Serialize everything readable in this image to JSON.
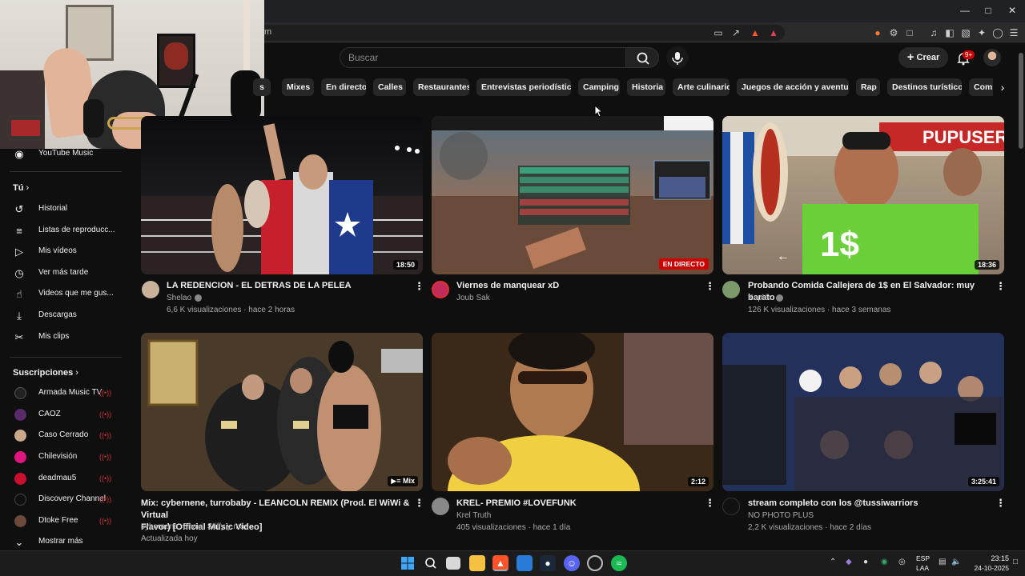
{
  "browser": {
    "url_text": "m",
    "window_controls": [
      "minimize",
      "maximize",
      "close"
    ]
  },
  "header": {
    "search_placeholder": "Buscar",
    "create_label": "Crear",
    "notifications_badge": "9+"
  },
  "chips": [
    "s",
    "Mixes",
    "En directo",
    "Calles",
    "Restaurantes",
    "Entrevistas periodísticas",
    "Camping",
    "Historia",
    "Arte culinario",
    "Juegos de acción y aventuras",
    "Rap",
    "Destinos turísticos",
    "Comp"
  ],
  "sidebar": {
    "top_item": "YouTube Music",
    "you_header": "Tú",
    "you_items": [
      "Historial",
      "Listas de reproducc...",
      "Mis vídeos",
      "Ver más tarde",
      "Videos que me gus...",
      "Descargas",
      "Mis clips"
    ],
    "subs_header": "Suscripciones",
    "subs_items": [
      "Armada Music TV",
      "CAOZ",
      "Caso Cerrado",
      "Chilevisión",
      "deadmau5",
      "Discovery Channel",
      "Dtoke Free"
    ],
    "show_more": "Mostrar más"
  },
  "videos": [
    {
      "title": "LA REDENCION - EL DETRAS DE LA PELEA",
      "channel": "Shelao",
      "meta": "6,6 K visualizaciones · hace 2 horas",
      "duration": "18:50"
    },
    {
      "title": "Viernes de manquear xD",
      "channel": "Joub Sak",
      "meta": "",
      "duration": "EN DIRECTO"
    },
    {
      "title": "Probando Comida Callejera de 1$ en El Salvador: muy barato",
      "channel": "Kapléx",
      "meta": "126 K visualizaciones · hace 3 semanas",
      "duration": "18:36"
    },
    {
      "title_line1": "Mix: cybernene, turrobaby - LEANCOLN REMIX (Prod. El WiWi & Virtual",
      "title_line2": "Flavor) [Official Music Video]",
      "channel": "cybernene, Bhavi, Stiffy y más",
      "meta": "Actualizada hoy",
      "duration": "Mix"
    },
    {
      "title": "KREL- PREMIO #LOVEFUNK",
      "channel": "Krel Truth",
      "meta": "405 visualizaciones · hace 1 día",
      "duration": "2:12"
    },
    {
      "title": "stream completo con los @tussiwarriors",
      "channel": "NO PHOTO PLUS",
      "meta": "2,2 K visualizaciones · hace 2 días",
      "duration": "3:25:41"
    }
  ],
  "thumb_text": {
    "pupuseria": "PUPUSERIA",
    "one_dollar": "1$"
  },
  "taskbar": {
    "lang1": "ESP",
    "lang2": "LAA",
    "time": "23:15",
    "date": "24-10-2025"
  }
}
